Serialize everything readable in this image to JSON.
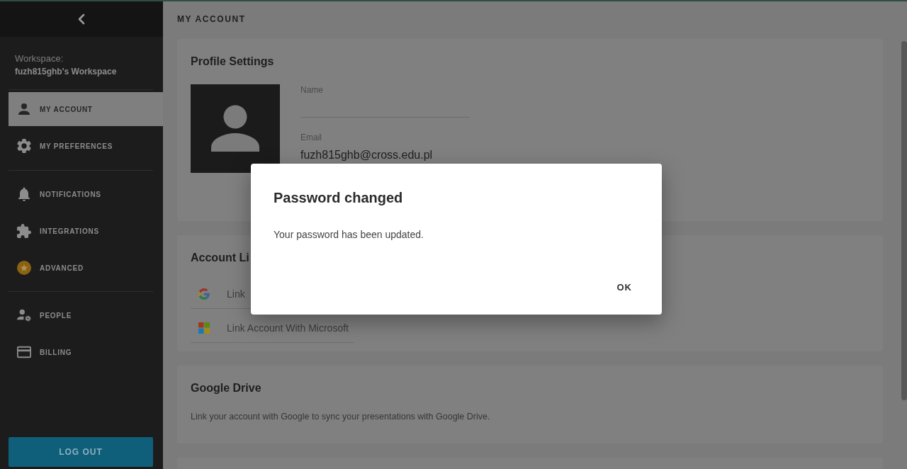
{
  "sidebar": {
    "workspace_label": "Workspace:",
    "workspace_name": "fuzh815ghb's Workspace",
    "groups": [
      {
        "items": [
          {
            "label": "MY ACCOUNT",
            "selected": true
          },
          {
            "label": "MY PREFERENCES",
            "selected": false
          }
        ]
      },
      {
        "items": [
          {
            "label": "NOTIFICATIONS",
            "selected": false
          },
          {
            "label": "INTEGRATIONS",
            "selected": false
          },
          {
            "label": "ADVANCED",
            "selected": false
          }
        ]
      },
      {
        "items": [
          {
            "label": "PEOPLE",
            "selected": false
          },
          {
            "label": "BILLING",
            "selected": false
          }
        ]
      }
    ],
    "logout_button": "LOG OUT"
  },
  "page_title": "MY ACCOUNT",
  "profile_settings": {
    "title": "Profile Settings",
    "fields": [
      {
        "kind": "input",
        "label": "Name"
      },
      {
        "kind": "text",
        "label": "Email",
        "value": "fuzh815ghb@cross.edu.pl"
      }
    ]
  },
  "account_links": {
    "title": "Account Li",
    "links": [
      "Link",
      "Link Account With Microsoft"
    ]
  },
  "google_drive": {
    "title": "Google Drive",
    "text": "Link your account with Google to sync your presentations with Google Drive."
  },
  "dialog": {
    "title": "Password changed",
    "message": "Your password has been updated.",
    "buttons": [
      "OK"
    ]
  }
}
